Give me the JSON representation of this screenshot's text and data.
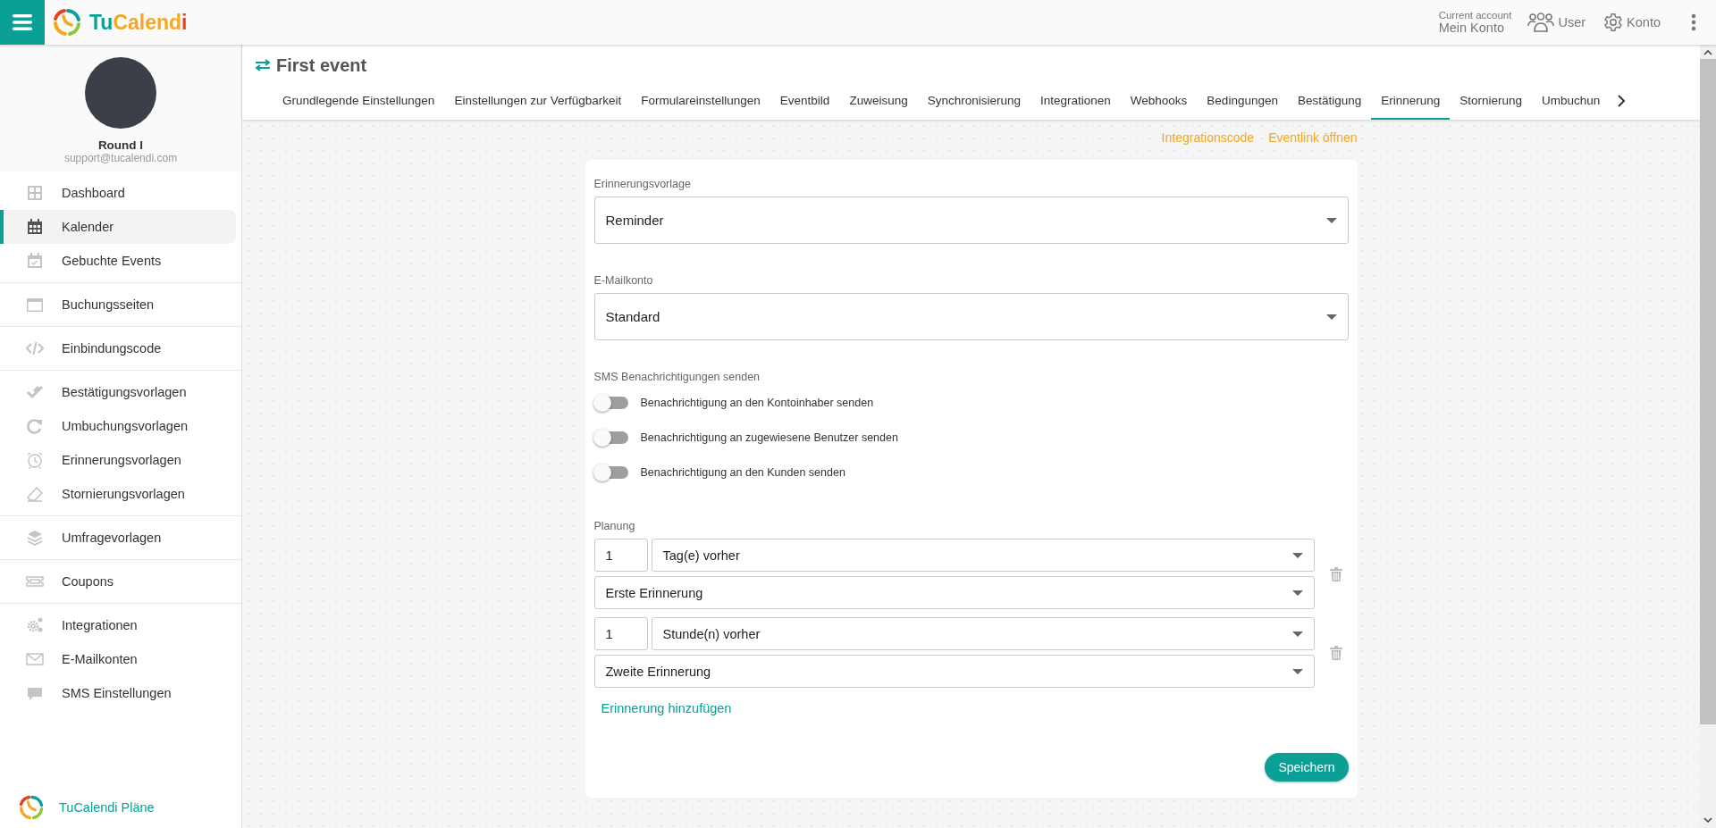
{
  "app_bar": {
    "logo_parts": [
      {
        "text": "Tu",
        "color": "#0aa096"
      },
      {
        "text": "Calend",
        "color": "#f5a623"
      },
      {
        "text": "i",
        "color": "#e8411f"
      }
    ],
    "account_caption": "Current account",
    "account_name": "Mein Konto",
    "user_label": "User",
    "konto_label": "Konto"
  },
  "sidebar": {
    "profile": {
      "name": "Round I",
      "email": "support@tucalendi.com"
    },
    "groups": [
      [
        {
          "label": "Dashboard",
          "selected": false
        },
        {
          "label": "Kalender",
          "selected": true
        },
        {
          "label": "Gebuchte Events",
          "selected": false
        }
      ],
      [
        {
          "label": "Buchungsseiten",
          "selected": false
        }
      ],
      [
        {
          "label": "Einbindungscode",
          "selected": false
        }
      ],
      [
        {
          "label": "Bestätigungsvorlagen",
          "selected": false
        },
        {
          "label": "Umbuchungsvorlagen",
          "selected": false
        },
        {
          "label": "Erinnerungsvorlagen",
          "selected": false
        },
        {
          "label": "Stornierungsvorlagen",
          "selected": false
        }
      ],
      [
        {
          "label": "Umfragevorlagen",
          "selected": false
        }
      ],
      [
        {
          "label": "Coupons",
          "selected": false
        }
      ],
      [
        {
          "label": "Integrationen",
          "selected": false
        },
        {
          "label": "E-Mailkonten",
          "selected": false
        },
        {
          "label": "SMS Einstellungen",
          "selected": false
        }
      ]
    ],
    "footer_label": "TuCalendi Pläne"
  },
  "page": {
    "title": "First event",
    "tabs": [
      {
        "label": "Grundlegende Einstellungen",
        "selected": false
      },
      {
        "label": "Einstellungen zur Verfügbarkeit",
        "selected": false
      },
      {
        "label": "Formulareinstellungen",
        "selected": false
      },
      {
        "label": "Eventbild",
        "selected": false
      },
      {
        "label": "Zuweisung",
        "selected": false
      },
      {
        "label": "Synchronisierung",
        "selected": false
      },
      {
        "label": "Integrationen",
        "selected": false
      },
      {
        "label": "Webhooks",
        "selected": false
      },
      {
        "label": "Bedingungen",
        "selected": false
      },
      {
        "label": "Bestätigung",
        "selected": false
      },
      {
        "label": "Erinnerung",
        "selected": true
      },
      {
        "label": "Stornierung",
        "selected": false
      },
      {
        "label": "Umbuchun",
        "selected": false
      }
    ],
    "links": [
      "Integrationscode",
      "Eventlink öffnen"
    ]
  },
  "form": {
    "template": {
      "label": "Erinnerungsvorlage",
      "value": "Reminder"
    },
    "email_account": {
      "label": "E-Mailkonto",
      "value": "Standard"
    },
    "sms": {
      "label": "SMS Benachrichtigungen senden",
      "toggles": [
        {
          "label": "Benachrichtigung an den Kontoinhaber senden",
          "on": false
        },
        {
          "label": "Benachrichtigung an zugewiesene Benutzer senden",
          "on": false
        },
        {
          "label": "Benachrichtigung an den Kunden senden",
          "on": false
        }
      ]
    },
    "schedule": {
      "label": "Planung",
      "reminders": [
        {
          "amount": "1",
          "unit": "Tag(e) vorher",
          "name": "Erste Erinnerung"
        },
        {
          "amount": "1",
          "unit": "Stunde(n) vorher",
          "name": "Zweite Erinnerung"
        }
      ]
    },
    "add_link": "Erinnerung hinzufügen",
    "save_button": "Speichern"
  }
}
